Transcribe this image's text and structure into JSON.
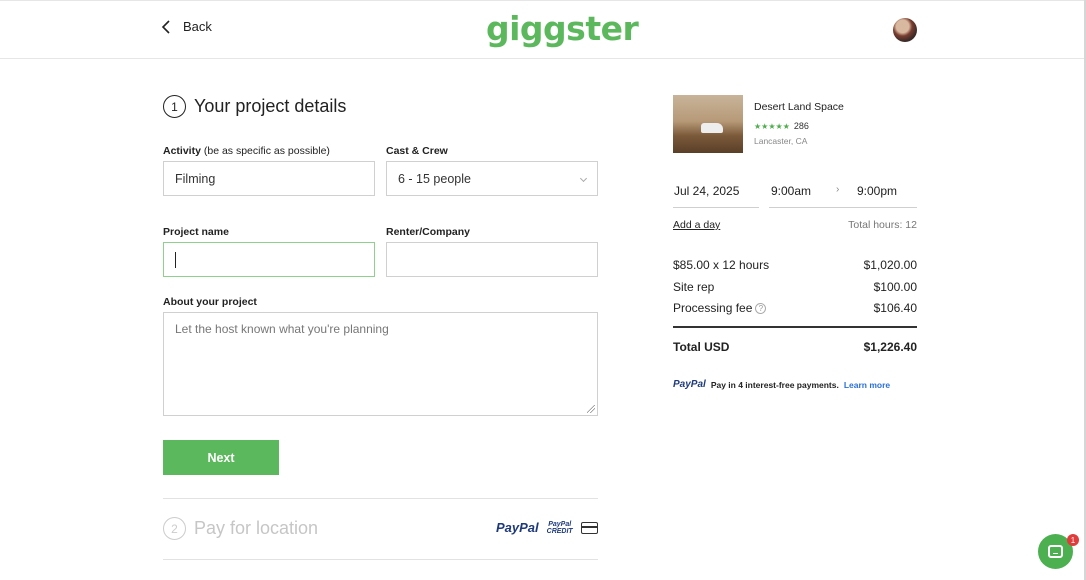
{
  "header": {
    "back_label": "Back",
    "logo_text": "giggster"
  },
  "form": {
    "step_number": "1",
    "title": "Your project details",
    "activity": {
      "label": "Activity",
      "hint": "(be as specific as possible)",
      "value": "Filming"
    },
    "cast_crew": {
      "label": "Cast & Crew",
      "value": "6 - 15 people"
    },
    "project_name": {
      "label": "Project name",
      "value": ""
    },
    "renter_company": {
      "label": "Renter/Company",
      "value": ""
    },
    "about": {
      "label": "About your project",
      "placeholder": "Let the host known what you're planning"
    },
    "next_label": "Next"
  },
  "step2": {
    "number": "2",
    "title": "Pay for location",
    "paypal_text": "PayPal",
    "paypal_credit_line1": "PayPal",
    "paypal_credit_line2": "CREDIT"
  },
  "booking": {
    "venue_name": "Desert Land Space",
    "rating_stars": "★★★★★",
    "review_count": "286",
    "location": "Lancaster, CA",
    "date": "Jul 24, 2025",
    "start_time": "9:00am",
    "time_arrow": "›",
    "end_time": "9:00pm",
    "add_day": "Add a day",
    "total_hours": "Total hours: 12",
    "lines": [
      {
        "label": "$85.00 x 12 hours",
        "amount": "$1,020.00"
      },
      {
        "label": "Site rep",
        "amount": "$100.00"
      },
      {
        "label": "Processing fee",
        "amount": "$106.40"
      }
    ],
    "total_label": "Total USD",
    "total_amount": "$1,226.40",
    "paypal_promo": {
      "logo": "PayPal",
      "text": "Pay in 4 interest-free payments.",
      "learn_more": "Learn more"
    }
  },
  "chat": {
    "badge_count": "1"
  },
  "colors": {
    "brand_green": "#5cb85c",
    "paypal_blue": "#1f3a7a",
    "link_blue": "#2a6fd6",
    "badge_red": "#e03c3c"
  }
}
